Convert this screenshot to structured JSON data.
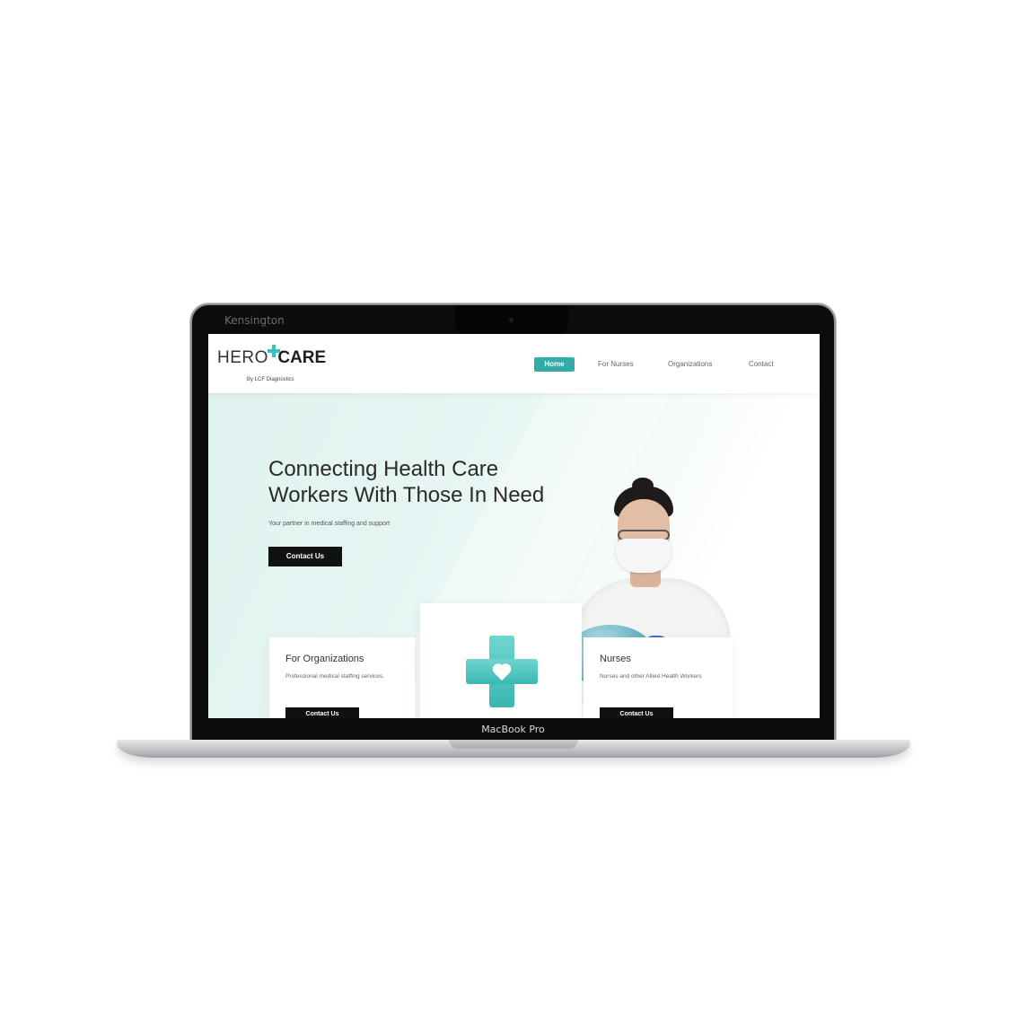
{
  "device": {
    "bezel_brand": "Kensington",
    "model_label": "MacBook Pro"
  },
  "site": {
    "logo": {
      "hero": "HERO",
      "care": "CARE",
      "subtitle": "By LCF Diagnostics"
    },
    "nav": {
      "items": [
        {
          "label": "Home",
          "active": true
        },
        {
          "label": "For Nurses",
          "active": false
        },
        {
          "label": "Organizations",
          "active": false
        },
        {
          "label": "Contact",
          "active": false
        }
      ]
    },
    "hero": {
      "headline_line1": "Connecting Health Care",
      "headline_line2": "Workers With Those In Need",
      "tagline": "Your partner in medical staffing and support",
      "cta_label": "Contact Us"
    },
    "cards": [
      {
        "title": "For Organizations",
        "text": "Professional medical staffing services.",
        "button": "Contact Us"
      },
      {
        "title": "Nurses",
        "text": "Nurses and other Allied Health Workers",
        "button": "Contact Us"
      }
    ],
    "colors": {
      "accent": "#34aba6",
      "hero_bg": "#dff2ef",
      "button_bg": "#111111"
    }
  }
}
